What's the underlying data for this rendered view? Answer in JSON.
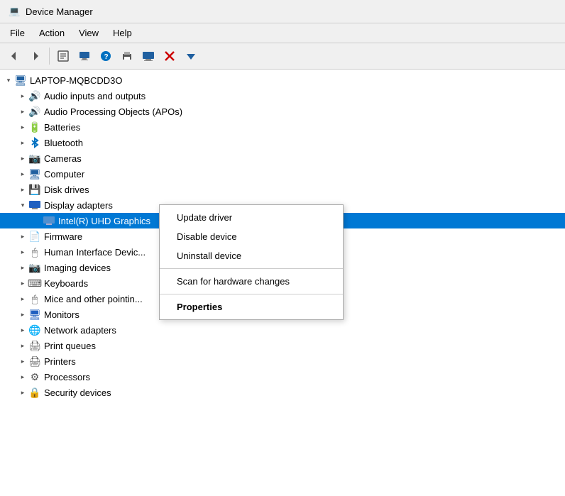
{
  "window": {
    "title": "Device Manager",
    "title_icon": "💻"
  },
  "menu": {
    "items": [
      {
        "id": "file",
        "label": "File"
      },
      {
        "id": "action",
        "label": "Action"
      },
      {
        "id": "view",
        "label": "View"
      },
      {
        "id": "help",
        "label": "Help"
      }
    ]
  },
  "toolbar": {
    "buttons": [
      {
        "id": "back",
        "icon": "◀",
        "label": "Back"
      },
      {
        "id": "forward",
        "icon": "▶",
        "label": "Forward"
      },
      {
        "id": "properties",
        "icon": "📋",
        "label": "Properties"
      },
      {
        "id": "update",
        "icon": "🖥",
        "label": "Update"
      },
      {
        "id": "help",
        "icon": "❓",
        "label": "Help"
      },
      {
        "id": "uninstall",
        "icon": "🖨",
        "label": "Uninstall"
      },
      {
        "id": "computer",
        "icon": "🖥",
        "label": "Computer"
      },
      {
        "id": "delete",
        "icon": "❌",
        "label": "Delete"
      },
      {
        "id": "scan",
        "icon": "⬇",
        "label": "Scan"
      }
    ]
  },
  "tree": {
    "root": {
      "label": "LAPTOP-MQBCDD3O",
      "expanded": true,
      "children": [
        {
          "id": "audio-inputs",
          "label": "Audio inputs and outputs",
          "indent": 1,
          "expanded": false,
          "icon": "🔊"
        },
        {
          "id": "audio-processing",
          "label": "Audio Processing Objects (APOs)",
          "indent": 1,
          "expanded": false,
          "icon": "🔊"
        },
        {
          "id": "batteries",
          "label": "Batteries",
          "indent": 1,
          "expanded": false,
          "icon": "🔋"
        },
        {
          "id": "bluetooth",
          "label": "Bluetooth",
          "indent": 1,
          "expanded": false,
          "icon": "🔵"
        },
        {
          "id": "cameras",
          "label": "Cameras",
          "indent": 1,
          "expanded": false,
          "icon": "📷"
        },
        {
          "id": "computer",
          "label": "Computer",
          "indent": 1,
          "expanded": false,
          "icon": "🖥"
        },
        {
          "id": "disk-drives",
          "label": "Disk drives",
          "indent": 1,
          "expanded": false,
          "icon": "💾"
        },
        {
          "id": "display-adapters",
          "label": "Display adapters",
          "indent": 1,
          "expanded": true,
          "icon": "🖥"
        },
        {
          "id": "intel-uhd",
          "label": "Intel(R) UHD Graphics",
          "indent": 2,
          "expanded": false,
          "icon": "🖥",
          "selected": true
        },
        {
          "id": "firmware",
          "label": "Firmware",
          "indent": 1,
          "expanded": false,
          "icon": "📄"
        },
        {
          "id": "hid",
          "label": "Human Interface Devic...",
          "indent": 1,
          "expanded": false,
          "icon": "🖱"
        },
        {
          "id": "imaging",
          "label": "Imaging devices",
          "indent": 1,
          "expanded": false,
          "icon": "📷"
        },
        {
          "id": "keyboards",
          "label": "Keyboards",
          "indent": 1,
          "expanded": false,
          "icon": "⌨"
        },
        {
          "id": "mice",
          "label": "Mice and other pointin...",
          "indent": 1,
          "expanded": false,
          "icon": "🖱"
        },
        {
          "id": "monitors",
          "label": "Monitors",
          "indent": 1,
          "expanded": false,
          "icon": "🖥"
        },
        {
          "id": "network",
          "label": "Network adapters",
          "indent": 1,
          "expanded": false,
          "icon": "🌐"
        },
        {
          "id": "print-queues",
          "label": "Print queues",
          "indent": 1,
          "expanded": false,
          "icon": "🖨"
        },
        {
          "id": "printers",
          "label": "Printers",
          "indent": 1,
          "expanded": false,
          "icon": "🖨"
        },
        {
          "id": "processors",
          "label": "Processors",
          "indent": 1,
          "expanded": false,
          "icon": "⚙"
        },
        {
          "id": "security",
          "label": "Security devices",
          "indent": 1,
          "expanded": false,
          "icon": "🔒"
        }
      ]
    }
  },
  "context_menu": {
    "items": [
      {
        "id": "update-driver",
        "label": "Update driver",
        "bold": false
      },
      {
        "id": "disable-device",
        "label": "Disable device",
        "bold": false
      },
      {
        "id": "uninstall-device",
        "label": "Uninstall device",
        "bold": false
      },
      {
        "id": "separator1",
        "type": "separator"
      },
      {
        "id": "scan-hardware",
        "label": "Scan for hardware changes",
        "bold": false
      },
      {
        "id": "separator2",
        "type": "separator"
      },
      {
        "id": "properties",
        "label": "Properties",
        "bold": true
      }
    ]
  }
}
